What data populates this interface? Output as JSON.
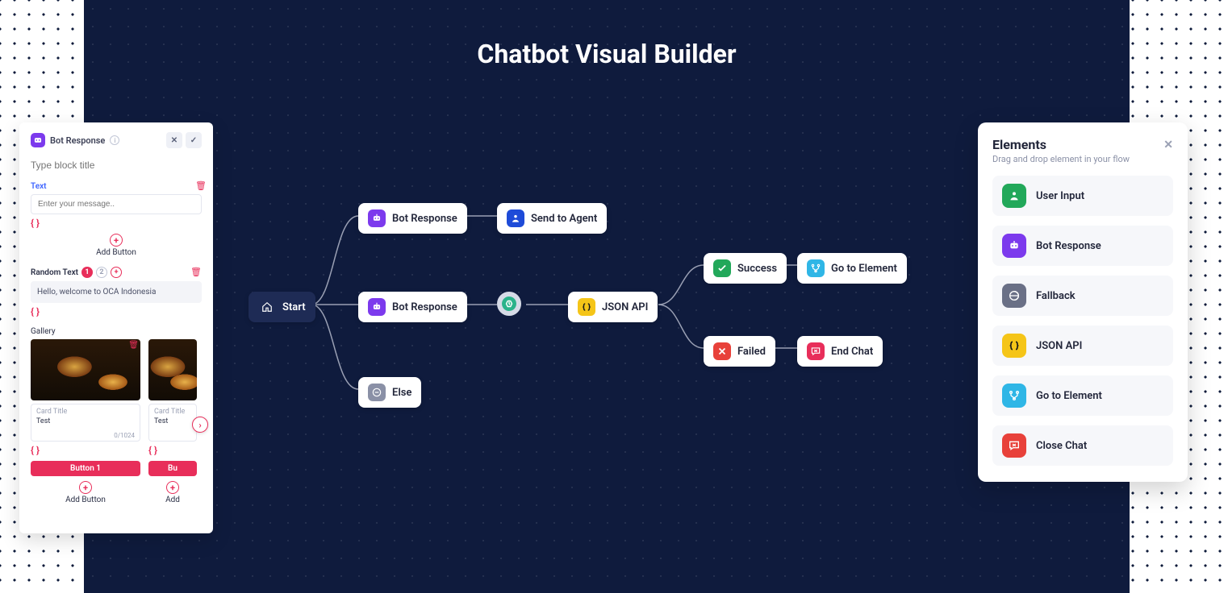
{
  "title": "Chatbot Visual Builder",
  "editor": {
    "header_label": "Bot Response",
    "block_title_placeholder": "Type block title",
    "text_label": "Text",
    "text_placeholder": "Enter your message..",
    "add_button_label": "Add Button",
    "random_text_label": "Random Text",
    "random_badge_1": "1",
    "random_badge_2": "2",
    "welcome_text": "Hello, welcome to OCA Indonesia",
    "gallery_label": "Gallery",
    "card1": {
      "title": "Card Title",
      "text": "Test",
      "counter": "0/1024",
      "button": "Button 1"
    },
    "card2": {
      "title": "Card Title",
      "text": "Test",
      "button": "Bu",
      "add": "Add"
    },
    "add_button_label2": "Add Button"
  },
  "nodes": {
    "start": "Start",
    "bot1": "Bot Response",
    "send_agent": "Send to Agent",
    "bot2": "Bot Response",
    "else": "Else",
    "json_api": "JSON API",
    "success": "Success",
    "failed": "Failed",
    "goto": "Go to Element",
    "end_chat": "End Chat"
  },
  "elements": {
    "title": "Elements",
    "subtitle": "Drag and drop element in your flow",
    "items": [
      {
        "label": "User Input",
        "color": "#22a85a"
      },
      {
        "label": "Bot Response",
        "color": "#7c3aed"
      },
      {
        "label": "Fallback",
        "color": "#6a7086"
      },
      {
        "label": "JSON API",
        "color": "#f5c518"
      },
      {
        "label": "Go to Element",
        "color": "#2fb6e6"
      },
      {
        "label": "Close Chat",
        "color": "#e8413a"
      }
    ]
  }
}
